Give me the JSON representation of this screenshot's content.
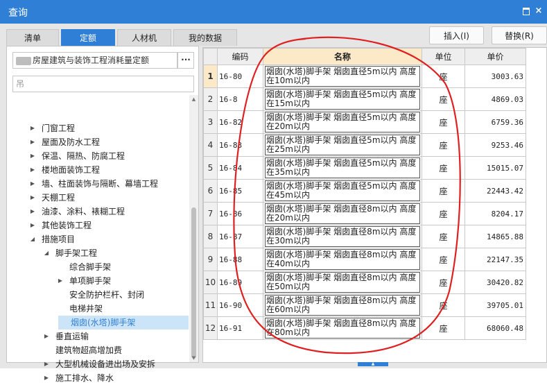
{
  "window": {
    "title": "查询",
    "restore_icon": "restore-icon",
    "close_glyph": "×"
  },
  "tabs": [
    {
      "label": "清单",
      "active": false
    },
    {
      "label": "定额",
      "active": true
    },
    {
      "label": "人材机",
      "active": false
    },
    {
      "label": "我的数据",
      "active": false
    }
  ],
  "actions": {
    "insert_label": "插入(I)",
    "replace_label": "替换(R)"
  },
  "quota_book": {
    "value": "房屋建筑与装饰工程消耗量定额",
    "more_label": "···"
  },
  "search": {
    "placeholder": "吊"
  },
  "tree": [
    {
      "label": "门窗工程",
      "level": 1,
      "expander": "▶"
    },
    {
      "label": "屋面及防水工程",
      "level": 1,
      "expander": "▶"
    },
    {
      "label": "保温、隔热、防腐工程",
      "level": 1,
      "expander": "▶"
    },
    {
      "label": "楼地面装饰工程",
      "level": 1,
      "expander": "▶"
    },
    {
      "label": "墙、柱面装饰与隔断、幕墙工程",
      "level": 1,
      "expander": "▶"
    },
    {
      "label": "天棚工程",
      "level": 1,
      "expander": "▶"
    },
    {
      "label": "油漆、涂料、裱糊工程",
      "level": 1,
      "expander": "▶"
    },
    {
      "label": "其他装饰工程",
      "level": 1,
      "expander": "▶"
    },
    {
      "label": "措施项目",
      "level": 1,
      "expander": "◢"
    },
    {
      "label": "脚手架工程",
      "level": 2,
      "expander": "◢"
    },
    {
      "label": "综合脚手架",
      "level": 3,
      "expander": ""
    },
    {
      "label": "单项脚手架",
      "level": 3,
      "expander": "▶"
    },
    {
      "label": "安全防护栏杆、封闭",
      "level": 3,
      "expander": ""
    },
    {
      "label": "电梯井架",
      "level": 3,
      "expander": ""
    },
    {
      "label": "烟囱(水塔)脚手架",
      "level": 3,
      "expander": "",
      "selected": true
    },
    {
      "label": "垂直运输",
      "level": 2,
      "expander": "▶"
    },
    {
      "label": "建筑物超高增加费",
      "level": 2,
      "expander": ""
    },
    {
      "label": "大型机械设备进出场及安拆",
      "level": 2,
      "expander": "▶"
    },
    {
      "label": "施工排水、降水",
      "level": 2,
      "expander": "▶"
    }
  ],
  "grid": {
    "headers": {
      "code": "编码",
      "name": "名称",
      "unit": "单位",
      "price": "单价"
    },
    "rows": [
      {
        "no": "1",
        "code": "16-80",
        "name": "烟囱(水塔)脚手架 烟囱直径5m以内 高度在10m以内",
        "unit": "座",
        "price": "3003.63"
      },
      {
        "no": "2",
        "code": "16-8",
        "name": "烟囱(水塔)脚手架 烟囱直径5m以内 高度在15m以内",
        "unit": "座",
        "price": "4869.03"
      },
      {
        "no": "3",
        "code": "16-82",
        "name": "烟囱(水塔)脚手架 烟囱直径5m以内 高度在20m以内",
        "unit": "座",
        "price": "6759.36"
      },
      {
        "no": "4",
        "code": "16-83",
        "name": "烟囱(水塔)脚手架 烟囱直径5m以内 高度在25m以内",
        "unit": "座",
        "price": "9253.46"
      },
      {
        "no": "5",
        "code": "16-84",
        "name": "烟囱(水塔)脚手架 烟囱直径5m以内 高度在35m以内",
        "unit": "座",
        "price": "15015.07"
      },
      {
        "no": "6",
        "code": "16-85",
        "name": "烟囱(水塔)脚手架 烟囱直径5m以内 高度在45m以内",
        "unit": "座",
        "price": "22443.42"
      },
      {
        "no": "7",
        "code": "16-86",
        "name": "烟囱(水塔)脚手架 烟囱直径8m以内 高度在20m以内",
        "unit": "座",
        "price": "8204.17"
      },
      {
        "no": "8",
        "code": "16-87",
        "name": "烟囱(水塔)脚手架 烟囱直径8m以内 高度在30m以内",
        "unit": "座",
        "price": "14865.88"
      },
      {
        "no": "9",
        "code": "16-88",
        "name": "烟囱(水塔)脚手架 烟囱直径8m以内 高度在40m以内",
        "unit": "座",
        "price": "22147.35"
      },
      {
        "no": "10",
        "code": "16-89",
        "name": "烟囱(水塔)脚手架 烟囱直径8m以内 高度在50m以内",
        "unit": "座",
        "price": "30420.82"
      },
      {
        "no": "11",
        "code": "16-90",
        "name": "烟囱(水塔)脚手架 烟囱直径8m以内 高度在60m以内",
        "unit": "座",
        "price": "39705.01"
      },
      {
        "no": "12",
        "code": "16-91",
        "name": "烟囱(水塔)脚手架 烟囱直径8m以内 高度在80m以内",
        "unit": "座",
        "price": "68060.48"
      }
    ]
  },
  "colors": {
    "accent": "#2f7fd6",
    "highlight": "#fbe9c8",
    "selection": "#cce4f7",
    "annotation": "#e02020"
  }
}
